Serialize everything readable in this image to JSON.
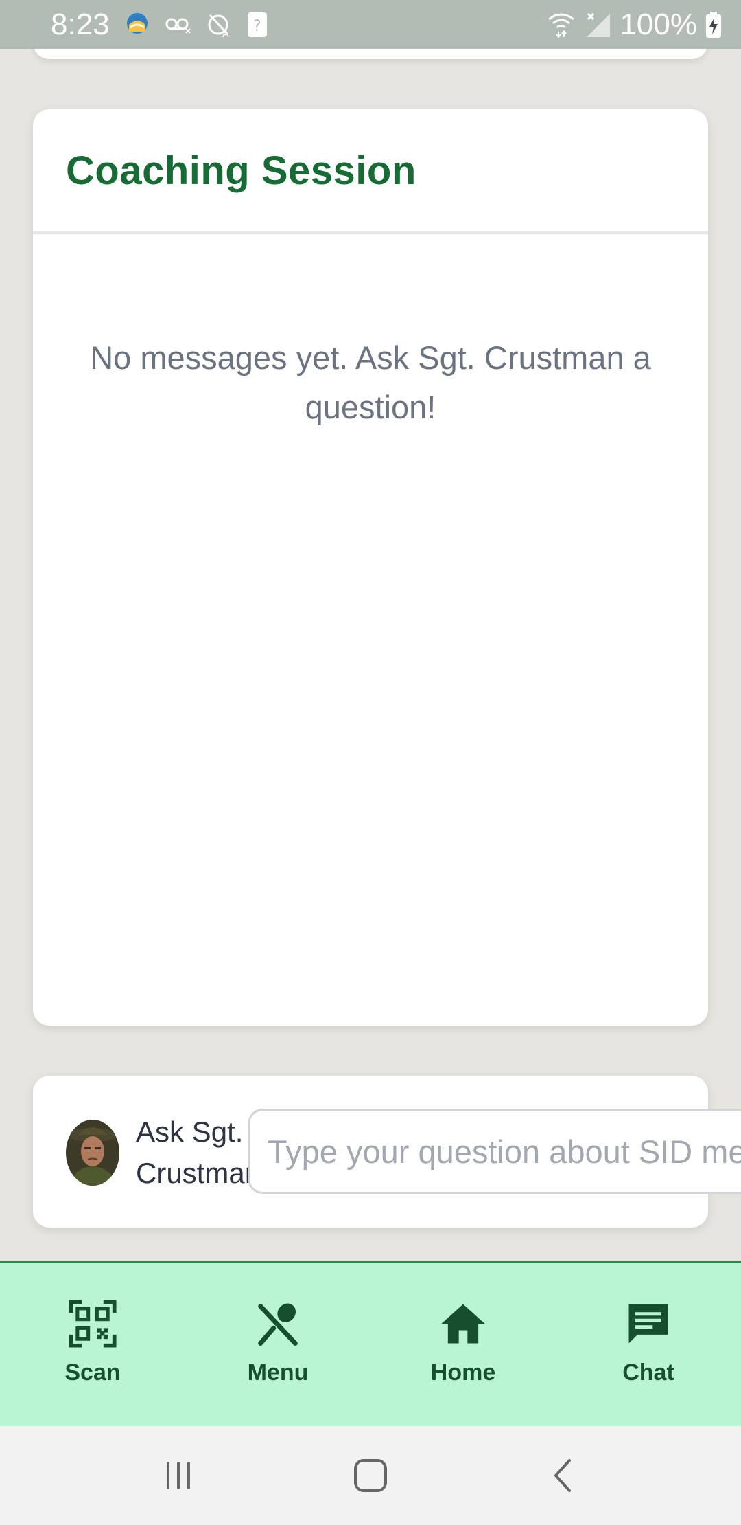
{
  "status_bar": {
    "time": "8:23",
    "battery_percent": "100%",
    "icons_left": [
      "weather-app-icon",
      "voicemail-icon",
      "alarm-off-icon",
      "unknown-sim-icon"
    ],
    "icons_right": [
      "wifi-icon",
      "signal-icon",
      "battery-charging-icon"
    ]
  },
  "coaching": {
    "title": "Coaching Session",
    "empty_message": "No messages yet. Ask Sgt. Crustman a question!"
  },
  "ask": {
    "label": "Ask Sgt. Crustman",
    "placeholder": "Type your question about SID menu items...",
    "value": ""
  },
  "tabs": [
    {
      "label": "Scan",
      "icon": "qr-scan-icon"
    },
    {
      "label": "Menu",
      "icon": "fork-spoon-icon"
    },
    {
      "label": "Home",
      "icon": "home-icon"
    },
    {
      "label": "Chat",
      "icon": "chat-icon"
    }
  ],
  "colors": {
    "title_green": "#176b34",
    "tab_bar_bg": "#b9f5d3",
    "tab_icon": "#174f2c",
    "page_bg": "#e6e5df"
  },
  "system_nav": [
    "recent-apps-icon",
    "home-icon",
    "back-icon"
  ]
}
